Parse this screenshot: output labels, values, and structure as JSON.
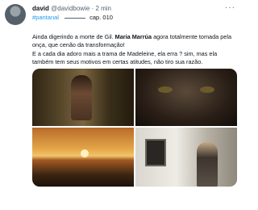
{
  "header": {
    "name": "david",
    "handle": "@davidbowie",
    "dot": "·",
    "time": "2 min",
    "more": "···"
  },
  "tags": {
    "hashtag": "#pantanal",
    "cap": "cap. 010"
  },
  "body": {
    "line1_pre": "Ainda digerindo a morte de Gil. ",
    "line1_bold": "Maria Marrúa",
    "line1_post": " agora totalmente tomada pela onça, que cenão da transformação!",
    "line2": "E a cada dia adoro mais a trama de Madeleine, ela erra ? sim, mas ela também tem seus motivos em certas atitudes, não tiro sua razão."
  },
  "media": {
    "images": [
      "img-1",
      "img-2",
      "img-3",
      "img-4"
    ]
  }
}
